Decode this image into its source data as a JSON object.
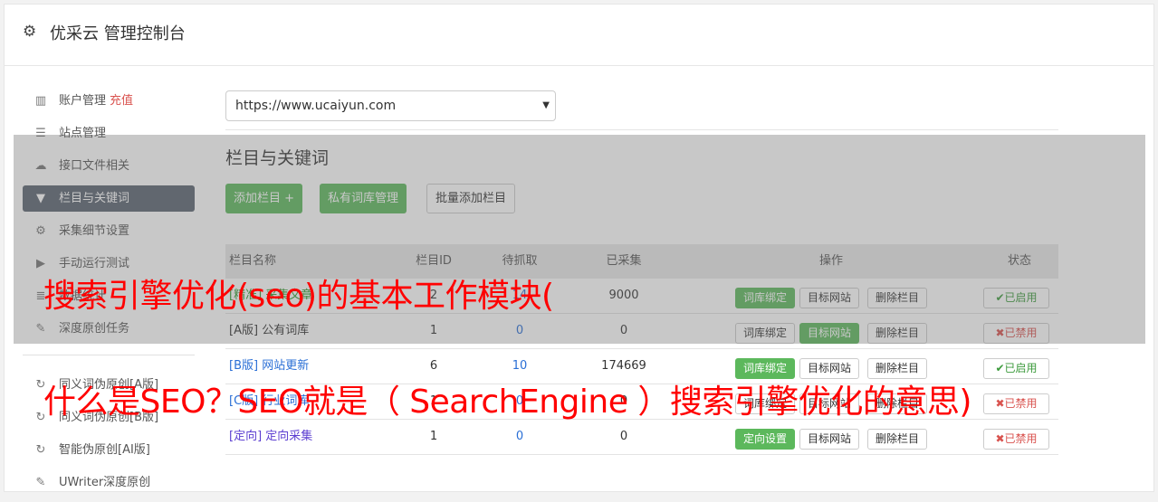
{
  "header": {
    "title": "优采云 管理控制台"
  },
  "sidebar": {
    "items": [
      {
        "label": "账户管理",
        "extra": "充值"
      },
      {
        "label": "站点管理"
      },
      {
        "label": "接口文件相关"
      },
      {
        "label": "栏目与关键词"
      },
      {
        "label": "采集细节设置"
      },
      {
        "label": "手动运行测试"
      },
      {
        "label": "数据统计"
      },
      {
        "label": "深度原创任务"
      }
    ],
    "items2": [
      {
        "label": "同义词伪原创[A版]"
      },
      {
        "label": "同义词伪原创[B版]"
      },
      {
        "label": "智能伪原创[AI版]"
      },
      {
        "label": "UWriter深度原创"
      }
    ]
  },
  "main": {
    "site_select": "https://www.ucaiyun.com",
    "section_title": "栏目与关键词",
    "buttons": {
      "add": "添加栏目 +",
      "private": "私有词库管理",
      "batch": "批量添加栏目"
    },
    "table": {
      "headers": [
        "栏目名称",
        "栏目ID",
        "待抓取",
        "已采集",
        "操作",
        "状态"
      ],
      "rows": [
        {
          "tag": "[精准]",
          "name": "采集文章",
          "id": "2",
          "pending": "14",
          "done": "9000",
          "op1": "词库绑定",
          "op2": "目标网站",
          "op3": "删除栏目",
          "status": "已启用"
        },
        {
          "tag": "[A版]",
          "name": "公有词库",
          "id": "1",
          "pending": "0",
          "done": "0",
          "op1": "词库绑定",
          "op2": "目标网站",
          "op3": "删除栏目",
          "status": "已禁用"
        },
        {
          "tag": "[B版]",
          "name": "网站更新",
          "id": "6",
          "pending": "10",
          "done": "174669",
          "op1": "词库绑定",
          "op2": "目标网站",
          "op3": "删除栏目",
          "status": "已启用"
        },
        {
          "tag": "[C版]",
          "name": "行业词库",
          "id": "1",
          "pending": "0",
          "done": "0",
          "op1": "词库绑定",
          "op2": "目标网站",
          "op3": "删除栏目",
          "status": "已禁用"
        },
        {
          "tag": "[定向]",
          "name": "定向采集",
          "id": "1",
          "pending": "0",
          "done": "0",
          "op1": "定向设置",
          "op2": "目标网站",
          "op3": "删除栏目",
          "status": "已禁用"
        }
      ]
    }
  },
  "overlay": {
    "line1": "搜索引擎优化(seo)的基本工作模块(",
    "line2": "什么是SEO？SEO就是（ SearchEngine ）搜索引擎优化的意思)"
  }
}
